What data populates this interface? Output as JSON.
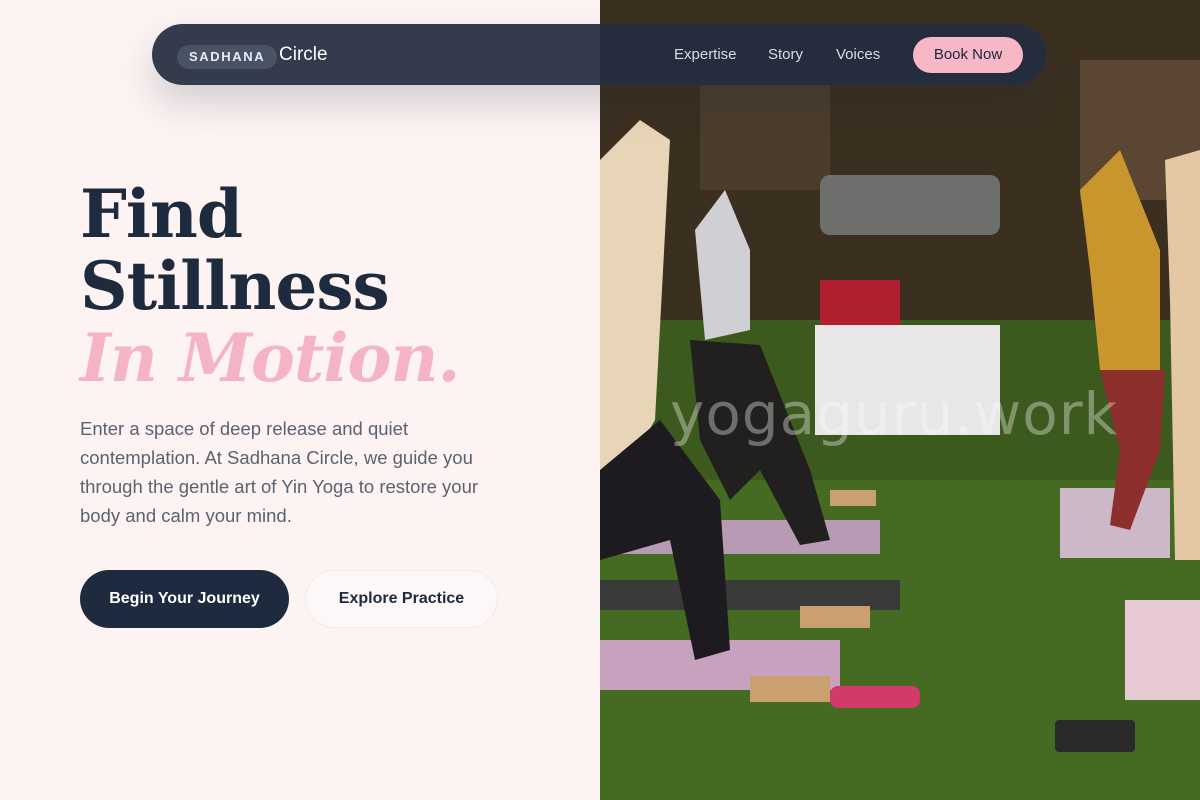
{
  "nav": {
    "brand_tag": "SADHANA",
    "brand_name": "Circle",
    "links": [
      "Expertise",
      "Story",
      "Voices"
    ],
    "cta": "Book Now"
  },
  "hero": {
    "title_line1": "Find",
    "title_line2": "Stillness",
    "title_line3": "In Motion.",
    "description": "Enter a space of deep release and quiet contemplation. At Sadhana Circle, we guide you through the gentle art of Yin Yoga to restore your body and calm your mind.",
    "primary_button": "Begin Your Journey",
    "secondary_button": "Explore Practice"
  },
  "image": {
    "watermark": "yogaguru.work"
  },
  "colors": {
    "navy": "#1e2a3e",
    "pink_accent": "#f5b4c6",
    "background": "#fdf3f3"
  }
}
